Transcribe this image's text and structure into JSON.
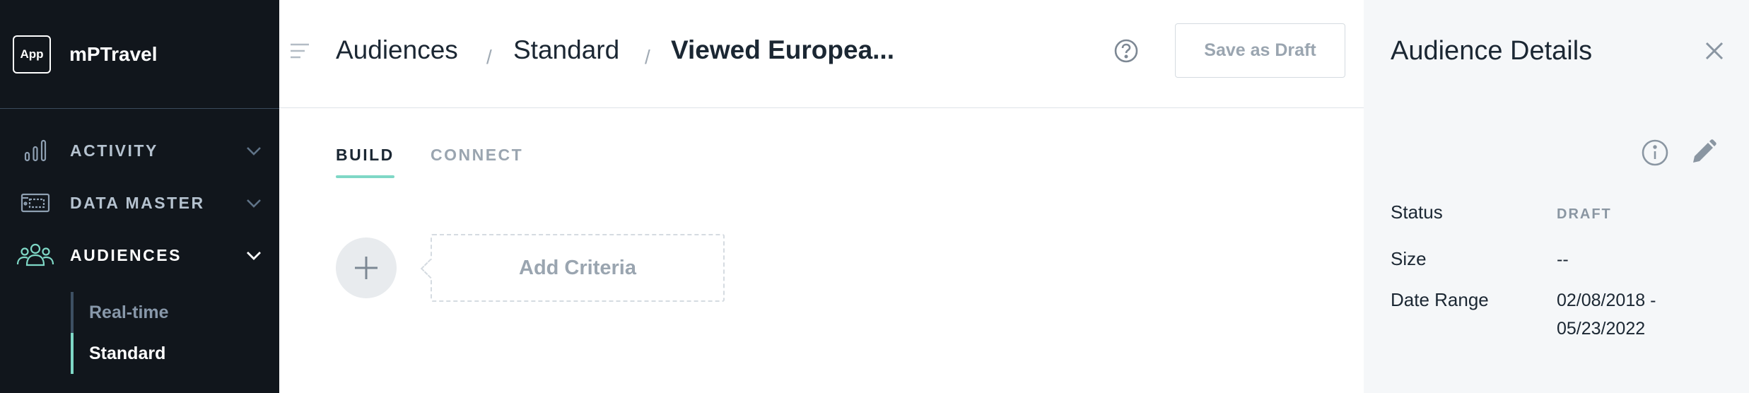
{
  "app": {
    "badge": "App",
    "name": "mPTravel"
  },
  "sidebar": {
    "items": [
      {
        "label": "ACTIVITY",
        "icon": "bar-chart-icon"
      },
      {
        "label": "DATA MASTER",
        "icon": "data-master-icon"
      },
      {
        "label": "AUDIENCES",
        "icon": "people-icon",
        "active": true
      }
    ],
    "subitems": [
      {
        "label": "Real-time"
      },
      {
        "label": "Standard",
        "active": true
      }
    ]
  },
  "header": {
    "breadcrumbs": [
      "Audiences",
      "Standard",
      "Viewed Europea..."
    ],
    "separator": "/",
    "save_draft_label": "Save as Draft"
  },
  "main": {
    "tabs": [
      {
        "label": "BUILD",
        "active": true
      },
      {
        "label": "CONNECT"
      }
    ],
    "add_criteria_label": "Add Criteria"
  },
  "panel": {
    "title": "Audience Details",
    "fields": [
      {
        "label": "Status",
        "value": "DRAFT"
      },
      {
        "label": "Size",
        "value": "--"
      },
      {
        "label": "Date Range",
        "value_line1": "02/08/2018 -",
        "value_line2": "05/23/2022"
      }
    ]
  },
  "colors": {
    "sidebar_bg": "#11161c",
    "accent": "#7fd8c6",
    "text_dark": "#1b2733",
    "text_muted": "#9aa5b0",
    "panel_bg": "#f5f7f9"
  }
}
